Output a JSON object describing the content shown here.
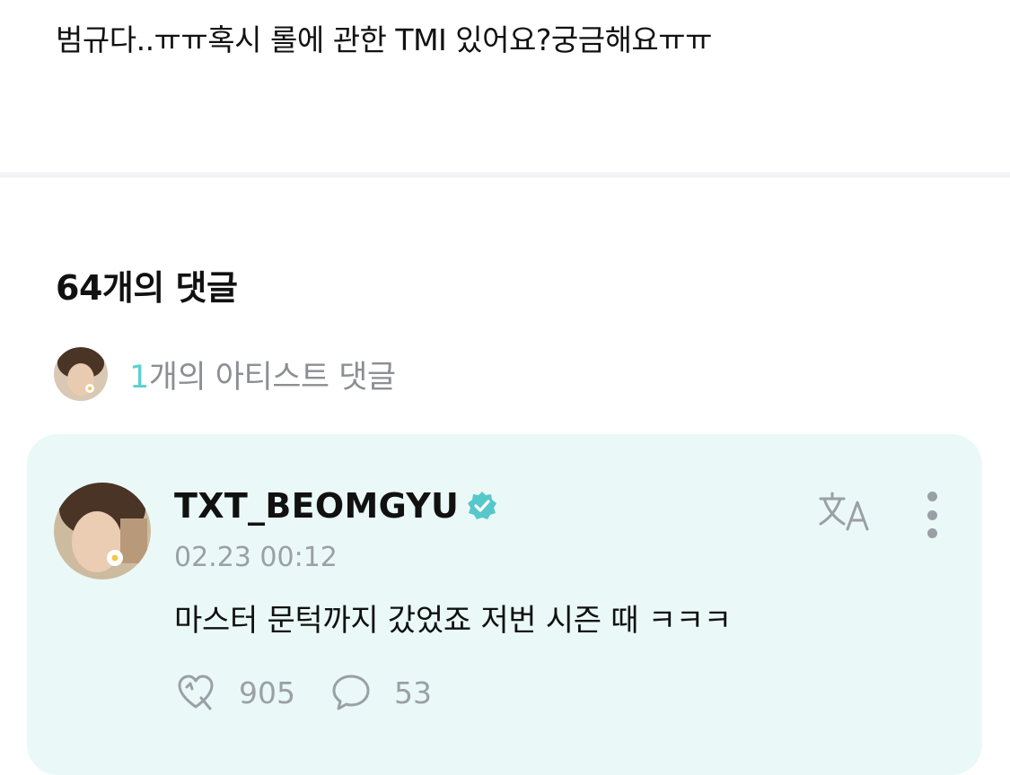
{
  "post": {
    "text": "범규다..ㅠㅠ혹시 롤에 관한 TMI 있어요?궁금해요ㅠㅠ"
  },
  "comments": {
    "count_label": "64개의 댓글",
    "artist_comments": {
      "count": "1",
      "label": "개의 아티스트 댓글"
    }
  },
  "artist_comment": {
    "username": "TXT_BEOMGYU",
    "timestamp": "02.23 00:12",
    "body": "마스터 문턱까지 갔었죠 저번 시즌 때 ㅋㅋㅋ",
    "likes": "905",
    "replies": "53",
    "icons": {
      "verified": "verified-badge-icon",
      "translate": "translate-icon",
      "more": "more-vertical-icon",
      "like": "cheer-heart-icon",
      "reply": "speech-bubble-icon"
    }
  },
  "colors": {
    "card_background": "#eaf9f7",
    "accent": "#5ad1d1",
    "verified": "#56c8ca",
    "muted": "#9aa0a6"
  }
}
